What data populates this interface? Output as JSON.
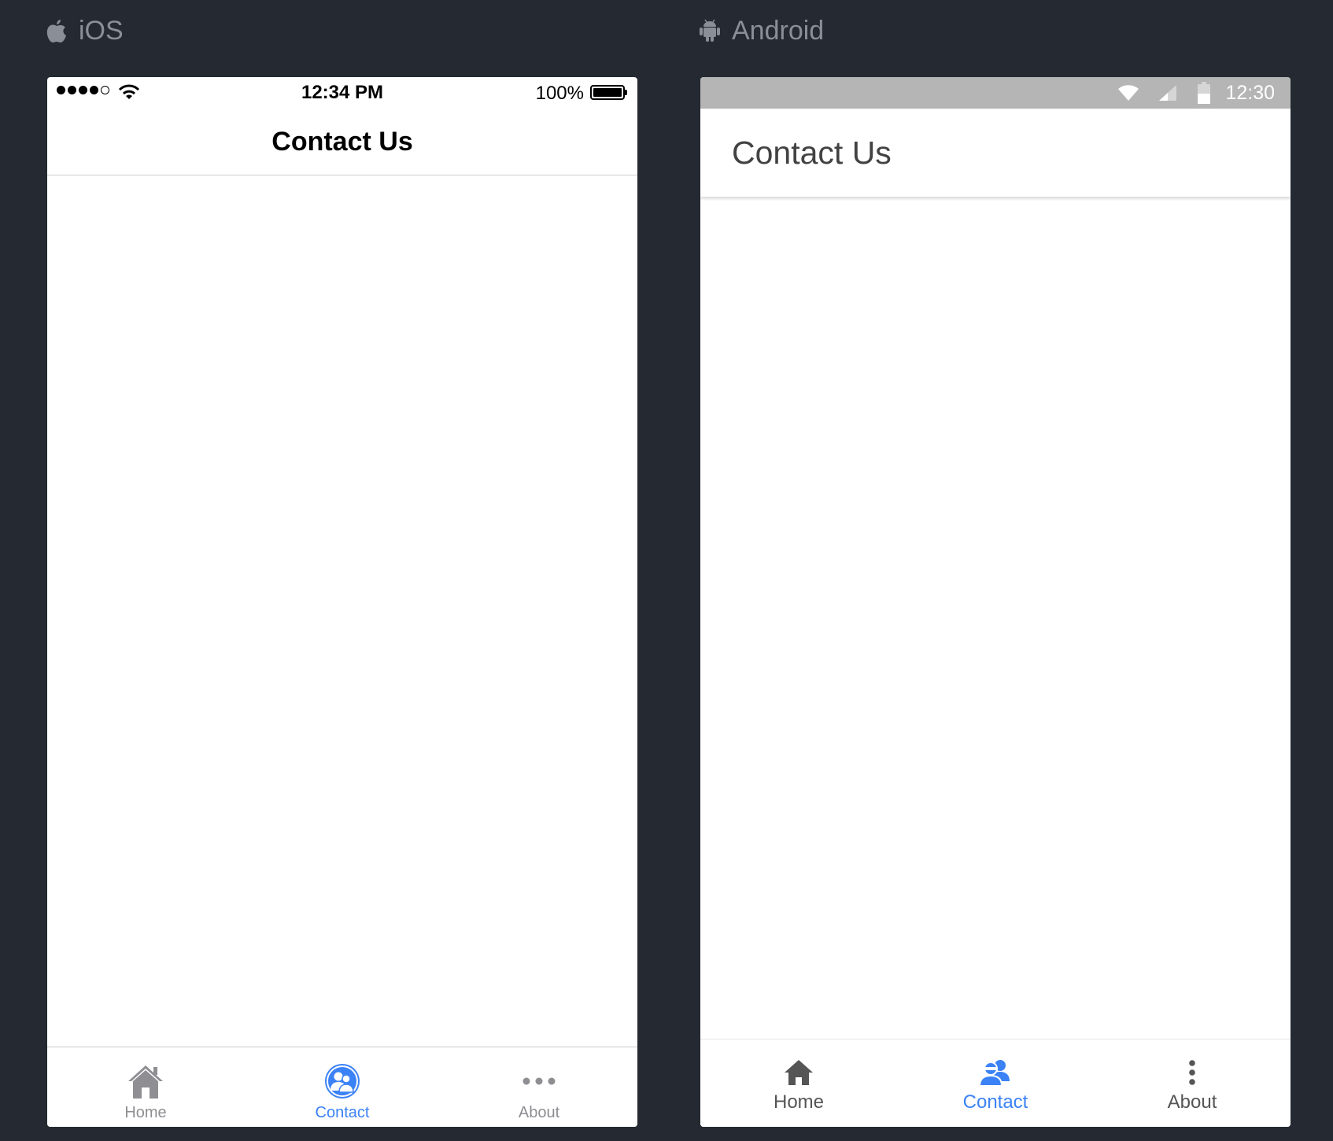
{
  "colors": {
    "background": "#252a32",
    "label": "#8a8f97",
    "accent": "#3b82f6",
    "ios_inactive": "#8e8e93",
    "android_inactive": "#555555",
    "android_statusbar": "#b5b5b5"
  },
  "ios": {
    "platform_label": "iOS",
    "platform_icon": "apple-icon",
    "status": {
      "time": "12:34 PM",
      "battery": "100%"
    },
    "nav_title": "Contact Us",
    "tabs": [
      {
        "label": "Home",
        "icon": "home-icon",
        "active": false
      },
      {
        "label": "Contact",
        "icon": "contacts-icon",
        "active": true
      },
      {
        "label": "About",
        "icon": "more-horizontal-icon",
        "active": false
      }
    ]
  },
  "android": {
    "platform_label": "Android",
    "platform_icon": "android-icon",
    "status": {
      "time": "12:30"
    },
    "app_title": "Contact Us",
    "tabs": [
      {
        "label": "Home",
        "icon": "home-icon",
        "active": false
      },
      {
        "label": "Contact",
        "icon": "contacts-icon",
        "active": true
      },
      {
        "label": "About",
        "icon": "more-vertical-icon",
        "active": false
      }
    ]
  }
}
